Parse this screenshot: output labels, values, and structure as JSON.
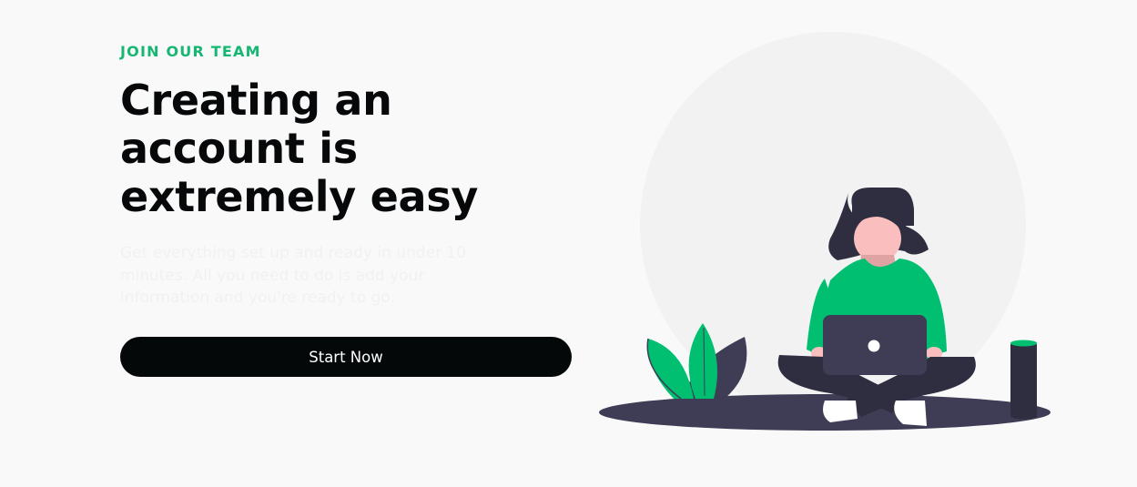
{
  "hero": {
    "eyebrow": "JOIN OUR TEAM",
    "headline": "Creating an account is extremely easy",
    "description": "Get everything set up and ready in under 10 minutes. All you need to do is add your information and you're ready to go.",
    "cta_label": "Start Now"
  },
  "colors": {
    "accent": "#16b772",
    "text_dark": "#060809",
    "button_bg": "#040809",
    "background": "#f9f9f9",
    "illustration_circle": "#f2f2f2",
    "illustration_dark": "#3f3d56",
    "illustration_green": "#00bf71"
  }
}
